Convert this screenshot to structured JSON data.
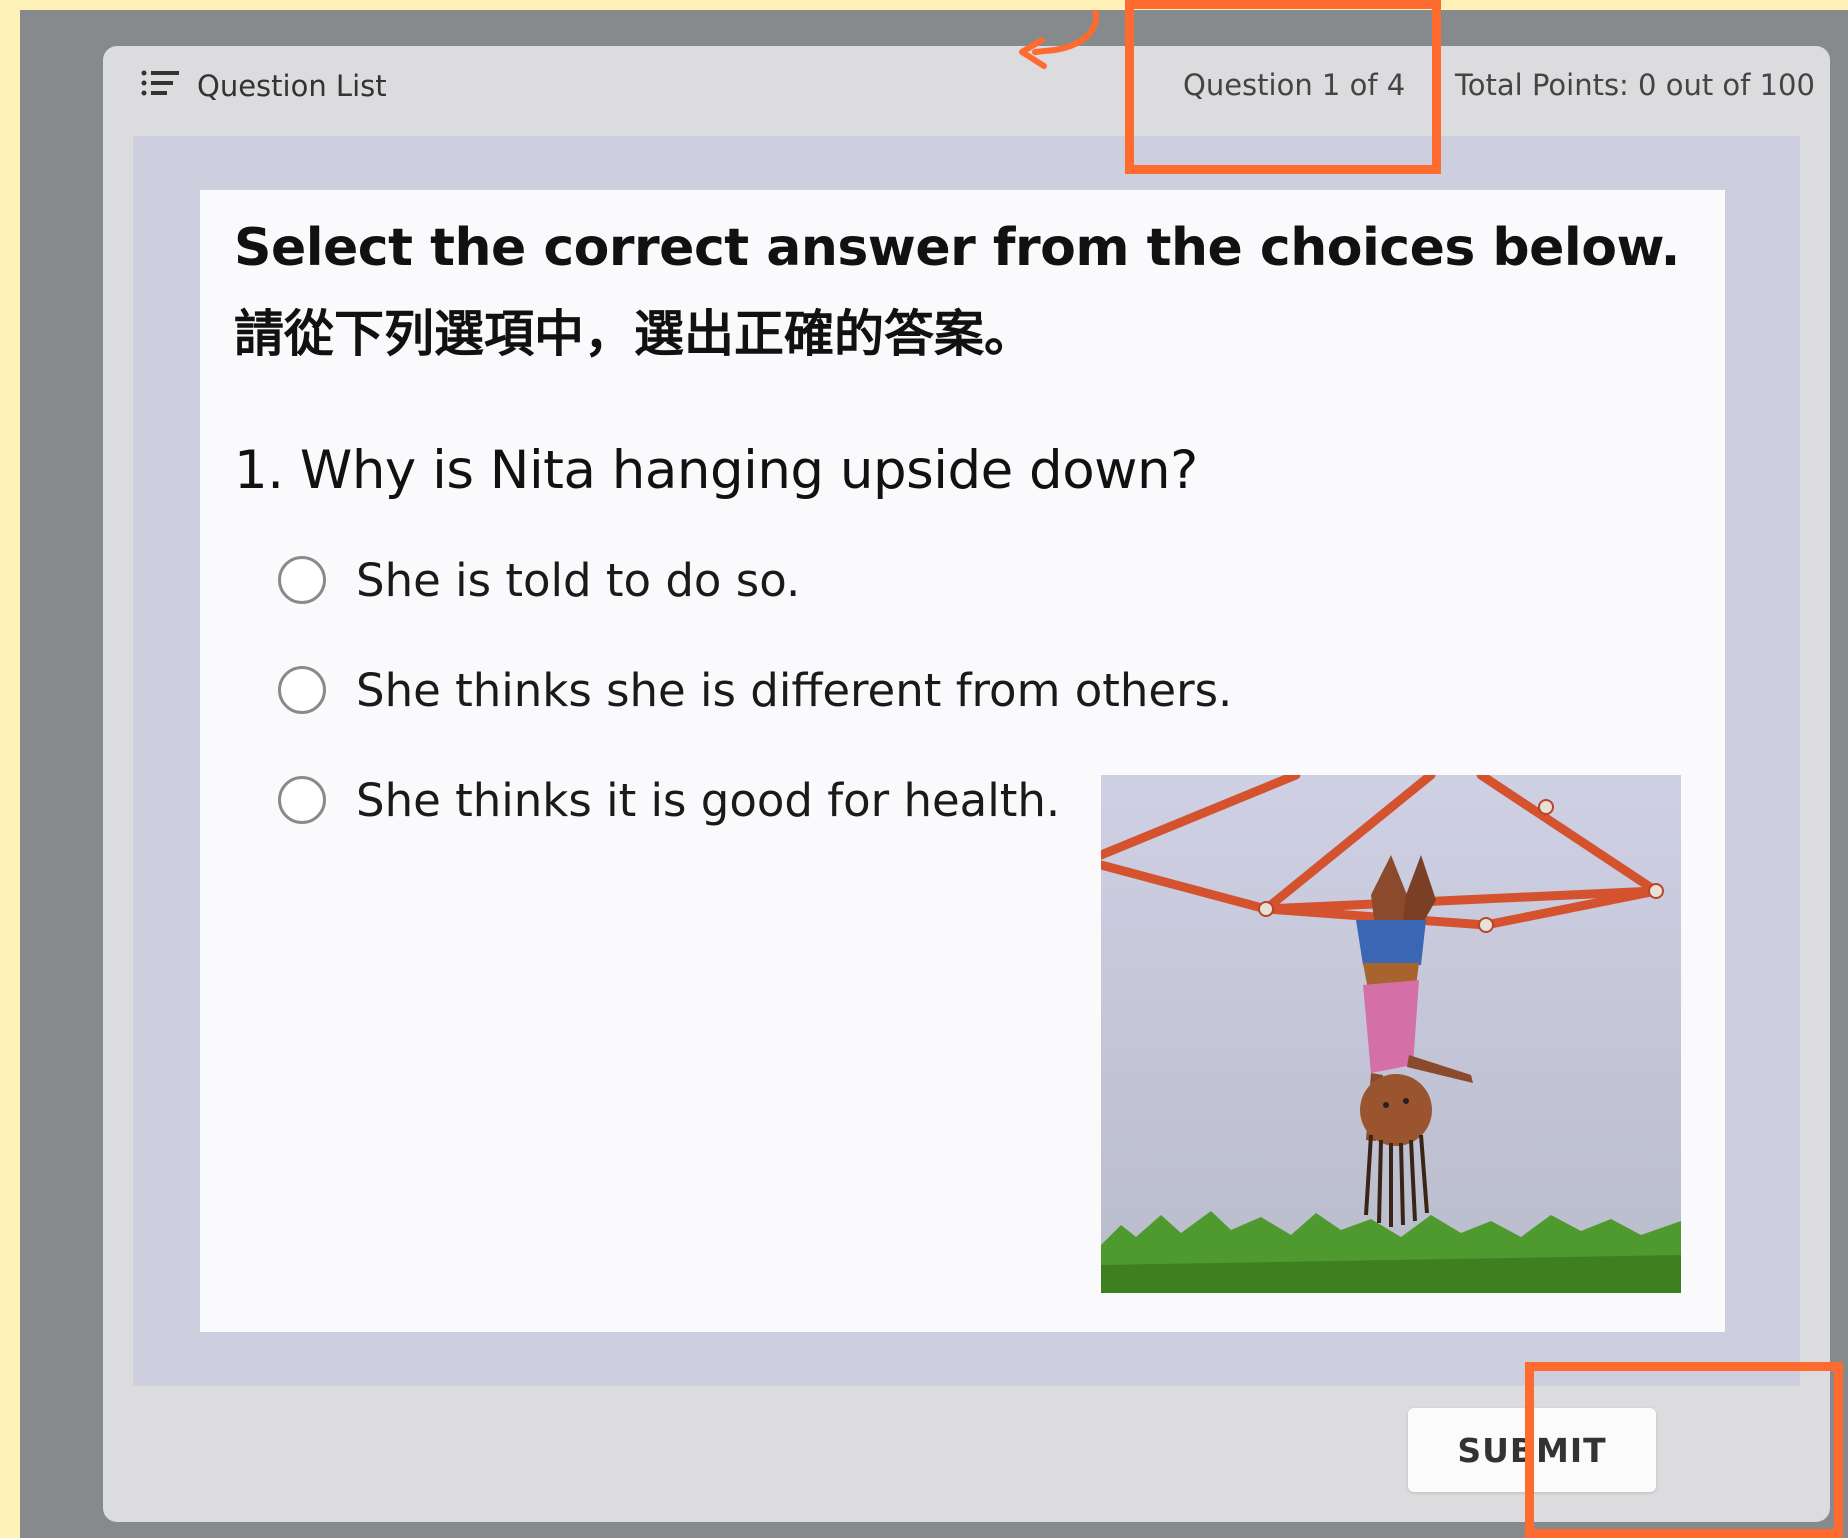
{
  "header": {
    "question_list_label": "Question List",
    "question_counter": "Question 1 of 4",
    "total_points": "Total Points: 0 out of 100"
  },
  "question": {
    "instruction_en": "Select the correct answer from the choices below.",
    "instruction_zh": "請從下列選項中，選出正確的答案。",
    "text": "1. Why is Nita hanging upside down?",
    "choices": [
      {
        "label": "She is told to do so.",
        "selected": false
      },
      {
        "label": "She thinks she is different from others.",
        "selected": false
      },
      {
        "label": "She thinks it is good for health.",
        "selected": false
      }
    ],
    "illustration": "girl-hanging-upside-down-on-climbing-frame"
  },
  "footer": {
    "submit_label": "SUBMIT"
  },
  "annotations": {
    "highlight_color": "#ff6a2e"
  },
  "colors": {
    "page_background": "#fef1b8",
    "frame": "#868a8c",
    "card": "#dcdbde",
    "stage": "#cdcfdf",
    "panel": "#fafafc"
  }
}
